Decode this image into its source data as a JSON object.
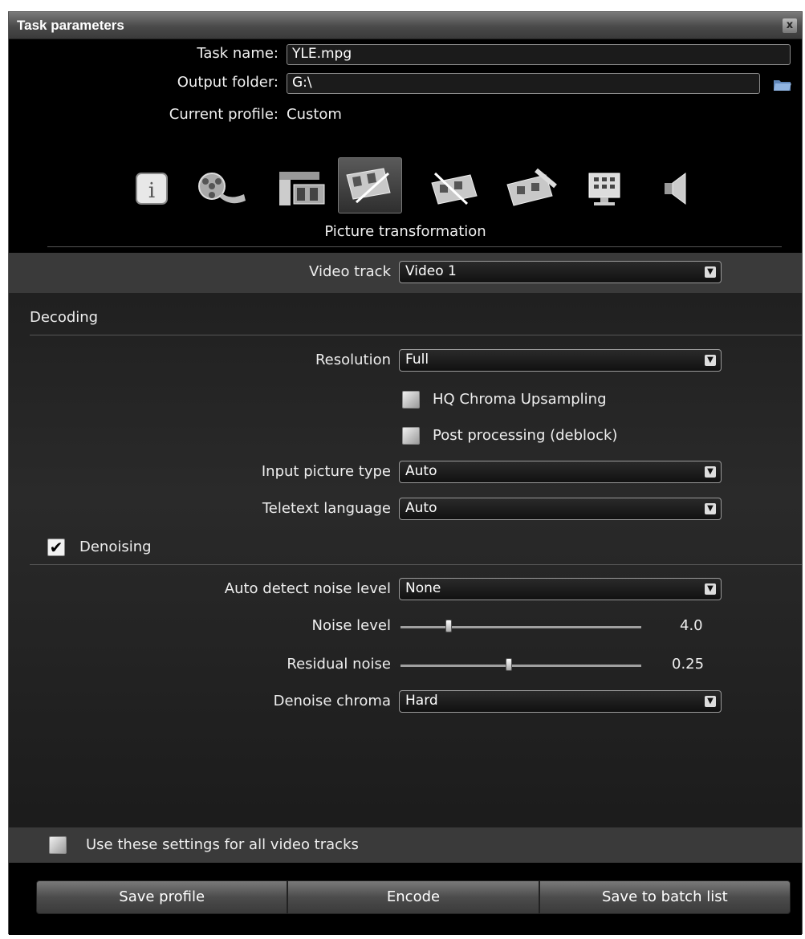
{
  "window": {
    "title": "Task parameters",
    "close_glyph": "x"
  },
  "task": {
    "name_label": "Task name:",
    "name_value": "YLE.mpg",
    "output_label": "Output folder:",
    "output_value": "G:\\",
    "profile_label": "Current profile:",
    "profile_value": "Custom"
  },
  "toolbar": {
    "icons": [
      {
        "name": "info-icon",
        "active": false
      },
      {
        "name": "film-reel-icon",
        "active": false
      },
      {
        "name": "film-clamp-icon",
        "active": false
      },
      {
        "name": "picture-transformation-icon",
        "active": true
      },
      {
        "name": "film-edit-icon",
        "active": false
      },
      {
        "name": "film-ruler-icon",
        "active": false
      },
      {
        "name": "monitor-icon",
        "active": false
      },
      {
        "name": "speaker-icon",
        "active": false
      }
    ],
    "section_caption": "Picture transformation"
  },
  "video_track": {
    "label": "Video track",
    "value": "Video 1"
  },
  "decoding": {
    "title": "Decoding",
    "resolution_label": "Resolution",
    "resolution_value": "Full",
    "hq_chroma_label": "HQ Chroma Upsampling",
    "hq_chroma_checked": false,
    "post_processing_label": "Post processing (deblock)",
    "post_processing_checked": false,
    "input_type_label": "Input picture type",
    "input_type_value": "Auto",
    "teletext_label": "Teletext language",
    "teletext_value": "Auto"
  },
  "denoising": {
    "title": "Denoising",
    "checked": true,
    "check_glyph": "✔",
    "auto_detect_label": "Auto detect noise level",
    "auto_detect_value": "None",
    "noise_level_label": "Noise level",
    "noise_level_value": "4.0",
    "noise_level_fraction": 0.2,
    "residual_label": "Residual noise",
    "residual_value": "0.25",
    "residual_fraction": 0.45,
    "chroma_label": "Denoise chroma",
    "chroma_value": "Hard"
  },
  "all_tracks": {
    "label": "Use these settings for all video tracks",
    "checked": false
  },
  "buttons": {
    "save_profile": "Save profile",
    "encode": "Encode",
    "save_batch": "Save to batch list"
  },
  "dropdown_arrow": "▼"
}
